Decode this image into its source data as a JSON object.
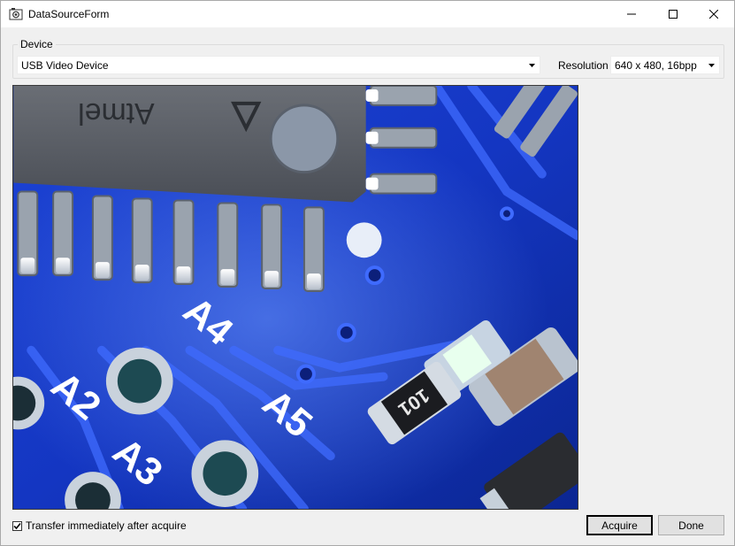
{
  "window": {
    "title": "DataSourceForm"
  },
  "device_group": {
    "legend": "Device",
    "device_value": "USB Video Device",
    "resolution_label": "Resolution",
    "resolution_value": "640 x 480, 16bpp"
  },
  "preview": {
    "pcb_labels": [
      "A2",
      "A3",
      "A4",
      "A5"
    ],
    "chip_marking": "Atmel",
    "resistor_marking": "101",
    "board_color": "#1636c9",
    "chip_color": "#5a5e66"
  },
  "footer": {
    "transfer_checkbox_label": "Transfer immediately after acquire",
    "transfer_checked": true,
    "acquire_label": "Acquire",
    "done_label": "Done"
  }
}
